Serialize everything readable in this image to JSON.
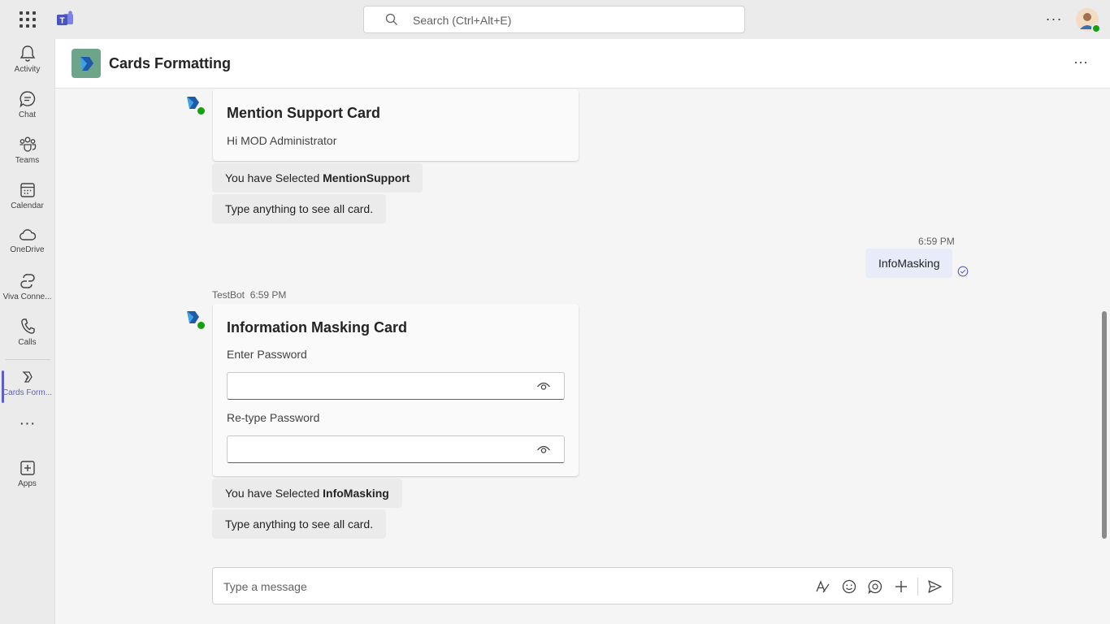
{
  "search": {
    "placeholder": "Search (Ctrl+Alt+E)"
  },
  "rail": {
    "items": [
      {
        "label": "Activity"
      },
      {
        "label": "Chat"
      },
      {
        "label": "Teams"
      },
      {
        "label": "Calendar"
      },
      {
        "label": "OneDrive"
      },
      {
        "label": "Viva Conne..."
      },
      {
        "label": "Calls"
      },
      {
        "label": "Cards Form..."
      },
      {
        "label": "Apps"
      }
    ]
  },
  "header": {
    "title": "Cards Formatting"
  },
  "messages": {
    "mention_card": {
      "title": "Mention Support Card",
      "text": "Hi MOD Administrator"
    },
    "selected1": {
      "prefix": "You have Selected ",
      "value": "MentionSupport"
    },
    "hint1": "Type anything to see all card.",
    "my_time": "6:59 PM",
    "my_text": "InfoMasking",
    "bot_name": "TestBot",
    "bot_time": "6:59 PM",
    "masking_card": {
      "title": "Information Masking Card",
      "password_label": "Enter Password",
      "retype_label": "Re-type Password"
    },
    "selected2": {
      "prefix": "You have Selected ",
      "value": "InfoMasking"
    },
    "hint2": "Type anything to see all card."
  },
  "compose": {
    "placeholder": "Type a message"
  },
  "colors": {
    "accent": "#5b5fc7",
    "presence": "#13a10e",
    "app_tile": "#6da58a"
  }
}
